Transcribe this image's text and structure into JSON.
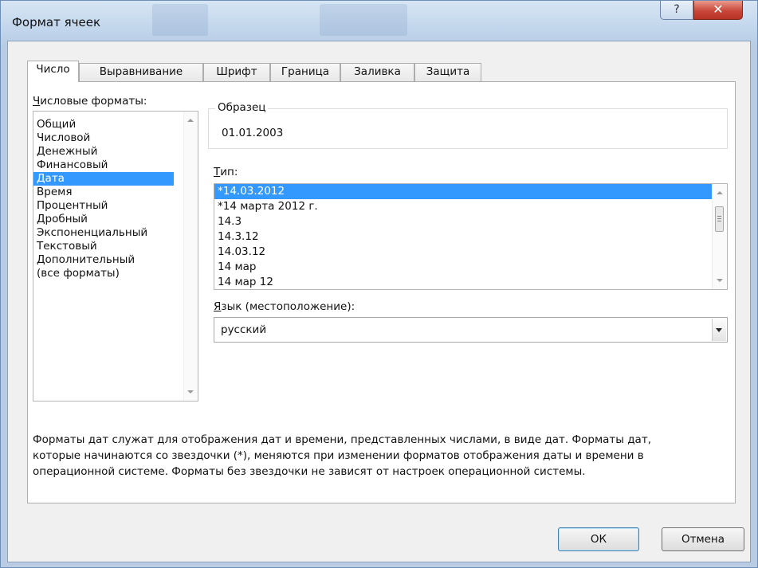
{
  "window": {
    "title": "Формат ячеек",
    "help_glyph": "?",
    "close_glyph": "✕"
  },
  "tabs": [
    {
      "label": "Число",
      "active": true
    },
    {
      "label": "Выравнивание"
    },
    {
      "label": "Шрифт"
    },
    {
      "label": "Граница"
    },
    {
      "label": "Заливка"
    },
    {
      "label": "Защита"
    }
  ],
  "number_formats": {
    "label_first": "Ч",
    "label_rest": "исловые форматы:",
    "items": [
      "Общий",
      "Числовой",
      "Денежный",
      "Финансовый",
      "Дата",
      "Время",
      "Процентный",
      "Дробный",
      "Экспоненциальный",
      "Текстовый",
      "Дополнительный",
      "(все форматы)"
    ],
    "selected": "Дата"
  },
  "sample": {
    "legend": "Образец",
    "value": "01.01.2003"
  },
  "type": {
    "label_first": "Т",
    "label_rest": "ип:",
    "items": [
      "*14.03.2012",
      "*14 марта 2012 г.",
      "14.3",
      "14.3.12",
      "14.03.12",
      "14 мар",
      "14 мар 12"
    ],
    "selected": "*14.03.2012"
  },
  "locale": {
    "label_first": "Я",
    "label_rest": "зык (местоположение):",
    "value": "русский"
  },
  "description": {
    "lines": [
      "Форматы дат служат для отображения дат и времени, представленных числами, в виде дат. Форматы дат,",
      "которые начинаются со звездочки (*), меняются при изменении форматов отображения даты и времени в",
      "операционной системе. Форматы без звездочки не зависят от настроек операционной системы."
    ]
  },
  "buttons": {
    "ok": "ОК",
    "cancel": "Отмена"
  },
  "colors": {
    "selection": "#3399ff",
    "close_button": "#c8473a",
    "title_bar": "#c2d6ec"
  }
}
